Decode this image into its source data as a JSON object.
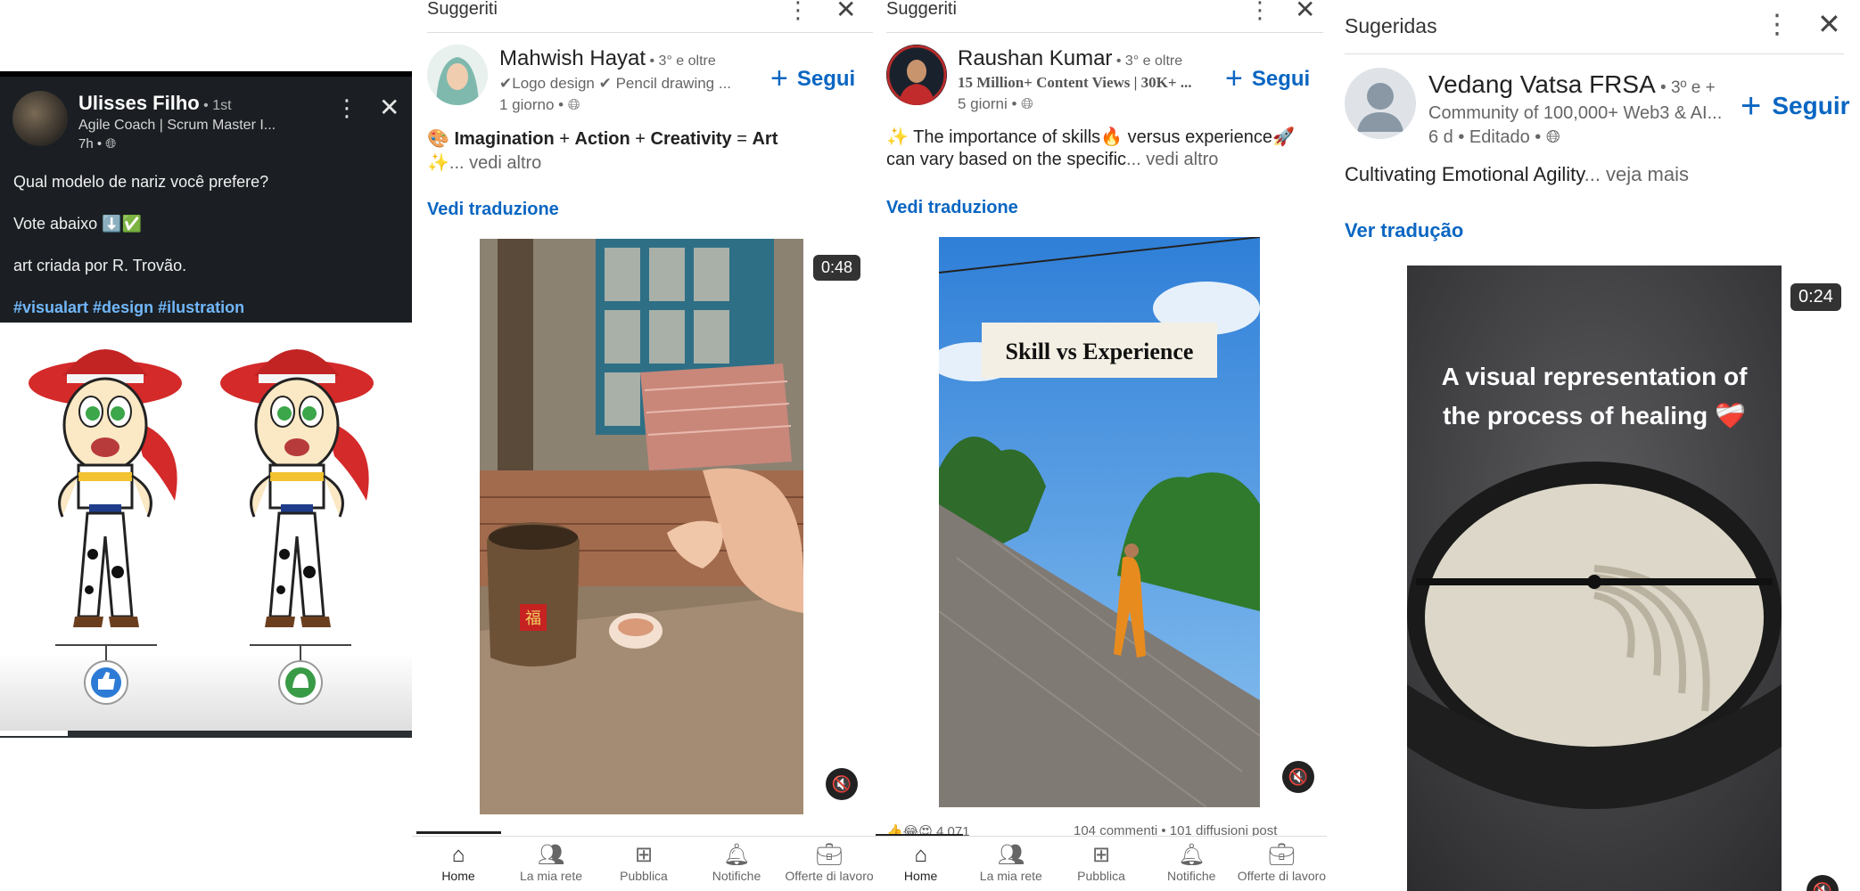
{
  "panel1": {
    "author_name": "Ulisses Filho",
    "degree": " • 1st",
    "headline": "Agile Coach | Scrum Master I...",
    "time": "7h • ",
    "lines": [
      "Qual modelo de nariz você prefere?",
      "Vote abaixo ⬇️✅",
      "art criada por R. Trovão."
    ],
    "hashtags": "#visualart #design #ilustration",
    "icons": {
      "more": "kebab-icon",
      "close": "close-icon",
      "globe": "globe-icon"
    }
  },
  "panel2": {
    "section_title": "Suggeriti",
    "author_name": "Mahwish Hayat",
    "degree": " • 3° e oltre",
    "headline": "✔Logo design ✔ Pencil drawing ...",
    "time": "1 giorno • ",
    "follow_label": "Segui",
    "post_bold": [
      "Imagination",
      "Action",
      "Creativity",
      "Art"
    ],
    "post_line2": "✨... vedi altro",
    "translate_label": "Vedi traduzione",
    "duration": "0:48"
  },
  "panel3": {
    "section_title": "Suggeriti",
    "author_name": "Raushan Kumar",
    "degree": " • 3° e oltre",
    "headline": "15 Million+ Content Views | 30K+ ...",
    "time": "5 giorni • ",
    "follow_label": "Segui",
    "post_line1": "✨ The importance of skills🔥 versus experience🚀",
    "post_line2": "can vary based on the specific",
    "post_more": "... vedi altro",
    "translate_label": "Vedi traduzione",
    "video_caption": "Skill vs Experience",
    "social_left": "4,071",
    "social_right": "104 commenti • 101 diffusioni post"
  },
  "panel4": {
    "section_title": "Sugeridas",
    "author_name": "Vedang Vatsa FRSA",
    "degree": " • 3º e +",
    "headline": "Community of 100,000+ Web3 & AI...",
    "time": "6 d • Editado • ",
    "follow_label": "Seguir",
    "post_text": "Cultivating Emotional Agility",
    "post_more": "... veja mais",
    "translate_label": "Ver tradução",
    "video_caption": "A visual representation of the process of healing ❤️‍🩹",
    "duration": "0:24"
  },
  "nav": {
    "items": [
      {
        "label": "Home",
        "icon": "home-icon"
      },
      {
        "label": "La mia rete",
        "icon": "network-icon"
      },
      {
        "label": "Pubblica",
        "icon": "post-icon"
      },
      {
        "label": "Notifiche",
        "icon": "bell-icon"
      },
      {
        "label": "Offerte di lavoro",
        "icon": "briefcase-icon"
      }
    ]
  },
  "colors": {
    "brand_blue": "#0a66c2",
    "dark_card": "#1b1f23",
    "hashtag": "#71b7fb"
  }
}
